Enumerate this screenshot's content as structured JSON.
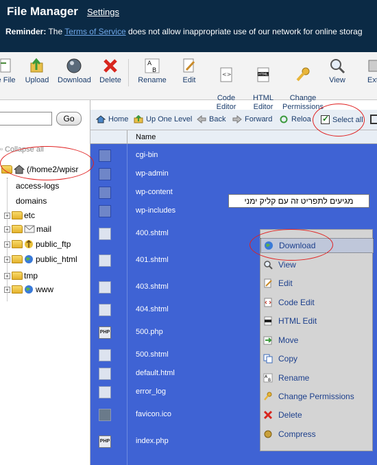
{
  "header": {
    "title": "File Manager",
    "settings": "Settings",
    "reminder_prefix": "Reminder:",
    "reminder_the": "The",
    "terms_link": "Terms of Service",
    "reminder_rest": "does not allow inappropriate use of our network for online storag"
  },
  "toolbar": {
    "items": [
      {
        "label": "e File"
      },
      {
        "label": "Upload"
      },
      {
        "label": "Download"
      },
      {
        "label": "Delete"
      },
      {
        "label": "Rename"
      },
      {
        "label": "Edit"
      },
      {
        "label": "Code\nEditor"
      },
      {
        "label": "HTML\nEditor"
      },
      {
        "label": "Change\nPermissions"
      },
      {
        "label": "View"
      },
      {
        "label": "Ext"
      }
    ]
  },
  "left": {
    "go": "Go",
    "collapse_all": "Collapse all",
    "root": "(/home2/wpisr",
    "tree": [
      "access-logs",
      "domains",
      "etc",
      "mail",
      "public_ftp",
      "public_html",
      "tmp",
      "www"
    ]
  },
  "nav": {
    "home": "Home",
    "up": "Up One Level",
    "back": "Back",
    "forward": "Forward",
    "reload": "Reloa",
    "select_all": "Select all"
  },
  "files": {
    "column_name": "Name",
    "rows": [
      {
        "name": "cgi-bin",
        "type": "folder"
      },
      {
        "name": "wp-admin",
        "type": "folder"
      },
      {
        "name": "wp-content",
        "type": "folder"
      },
      {
        "name": "wp-includes",
        "type": "folder"
      },
      {
        "name": "400.shtml",
        "type": "page"
      },
      {
        "name": "401.shtml",
        "type": "page"
      },
      {
        "name": "403.shtml",
        "type": "page"
      },
      {
        "name": "404.shtml",
        "type": "page"
      },
      {
        "name": "500.php",
        "type": "php"
      },
      {
        "name": "500.shtml",
        "type": "page"
      },
      {
        "name": "default.html",
        "type": "page"
      },
      {
        "name": "error_log",
        "type": "page"
      },
      {
        "name": "favicon.ico",
        "type": "img"
      },
      {
        "name": "index.php",
        "type": "php"
      }
    ]
  },
  "hint": "מגיעים לתפריט זה עם קליק ימני",
  "context_menu": {
    "items": [
      "Download",
      "View",
      "Edit",
      "Code Edit",
      "HTML Edit",
      "Move",
      "Copy",
      "Rename",
      "Change Permissions",
      "Delete",
      "Compress"
    ]
  },
  "colors": {
    "header_bg": "#0b2a45",
    "list_bg": "#3f63d4",
    "annotation": "#e02020"
  }
}
